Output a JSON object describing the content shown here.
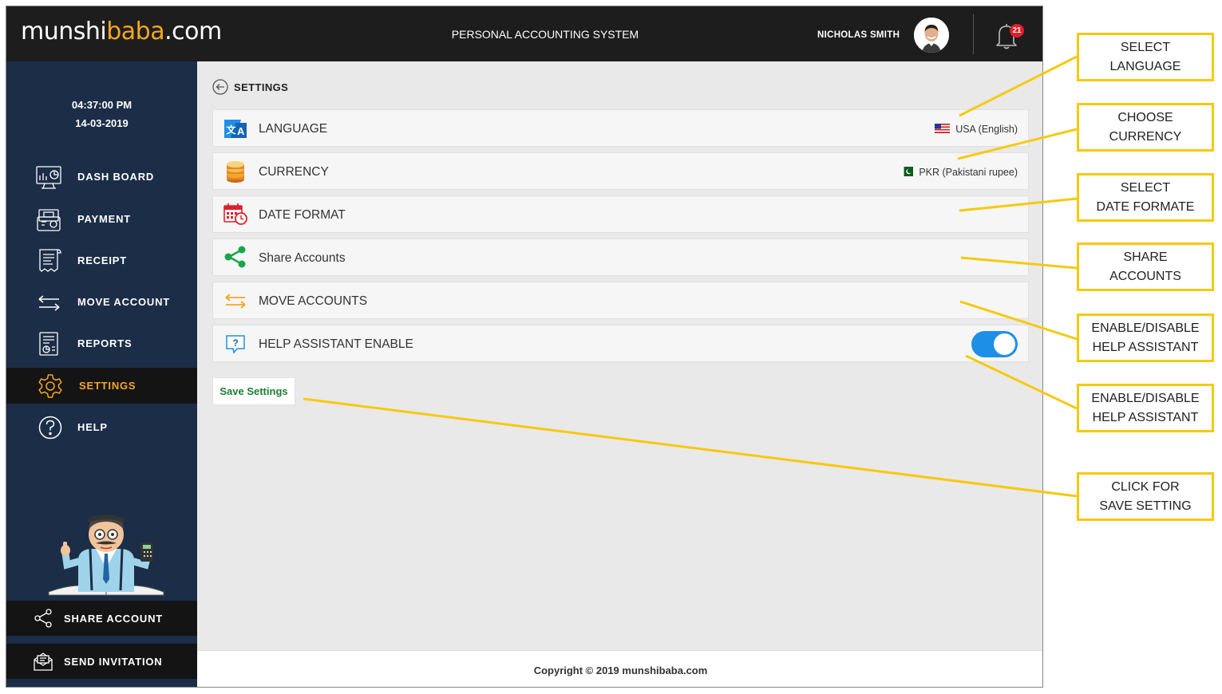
{
  "header": {
    "logo_part1": "munshi",
    "logo_part2": "baba",
    "logo_part3": ".com",
    "title": "PERSONAL ACCOUNTING SYSTEM",
    "user_name": "NICHOLAS SMITH",
    "notification_count": "21"
  },
  "sidebar": {
    "time": "04:37:00 PM",
    "date": "14-03-2019",
    "items": [
      {
        "label": "DASH BOARD",
        "icon": "dashboard-icon"
      },
      {
        "label": "PAYMENT",
        "icon": "payment-icon"
      },
      {
        "label": "RECEIPT",
        "icon": "receipt-icon"
      },
      {
        "label": "MOVE ACCOUNT",
        "icon": "move-account-icon"
      },
      {
        "label": "REPORTS",
        "icon": "reports-icon"
      },
      {
        "label": "SETTINGS",
        "icon": "gear-icon",
        "active": true
      },
      {
        "label": "HELP",
        "icon": "help-icon"
      }
    ],
    "share_account": "SHARE ACCOUNT",
    "send_invitation": "SEND INVITATION"
  },
  "main": {
    "breadcrumb": "SETTINGS",
    "settings": [
      {
        "label": "LANGUAGE",
        "value": "USA (English)",
        "icon": "translate-icon"
      },
      {
        "label": "CURRENCY",
        "value": "PKR (Pakistani rupee)",
        "icon": "coins-icon"
      },
      {
        "label": "DATE FORMAT",
        "icon": "calendar-clock-icon"
      },
      {
        "label": "Share Accounts",
        "icon": "share-icon"
      },
      {
        "label": "MOVE ACCOUNTS",
        "icon": "transfer-arrows-icon"
      },
      {
        "label": "HELP ASSISTANT ENABLE",
        "icon": "help-chat-icon",
        "toggle_on": true
      }
    ],
    "save_label": "Save Settings"
  },
  "footer": {
    "copyright": "Copyright © 2019 munshibaba.com"
  },
  "annotations": [
    "SELECT\nLANGUAGE",
    "CHOOSE\nCURRENCY",
    "SELECT\nDATE FORMATE",
    "SHARE\nACCOUNTS",
    "ENABLE/DISABLE\nHELP ASSISTANT",
    "ENABLE/DISABLE\nHELP ASSISTANT",
    "CLICK FOR\nSAVE SETTING"
  ],
  "colors": {
    "topbar": "#1d1d1d",
    "sidebar": "#1b2d47",
    "accent_orange": "#f5a623",
    "toggle_blue": "#1e8fe6",
    "save_green": "#1a7f33",
    "callout_yellow": "#f7c90f"
  }
}
